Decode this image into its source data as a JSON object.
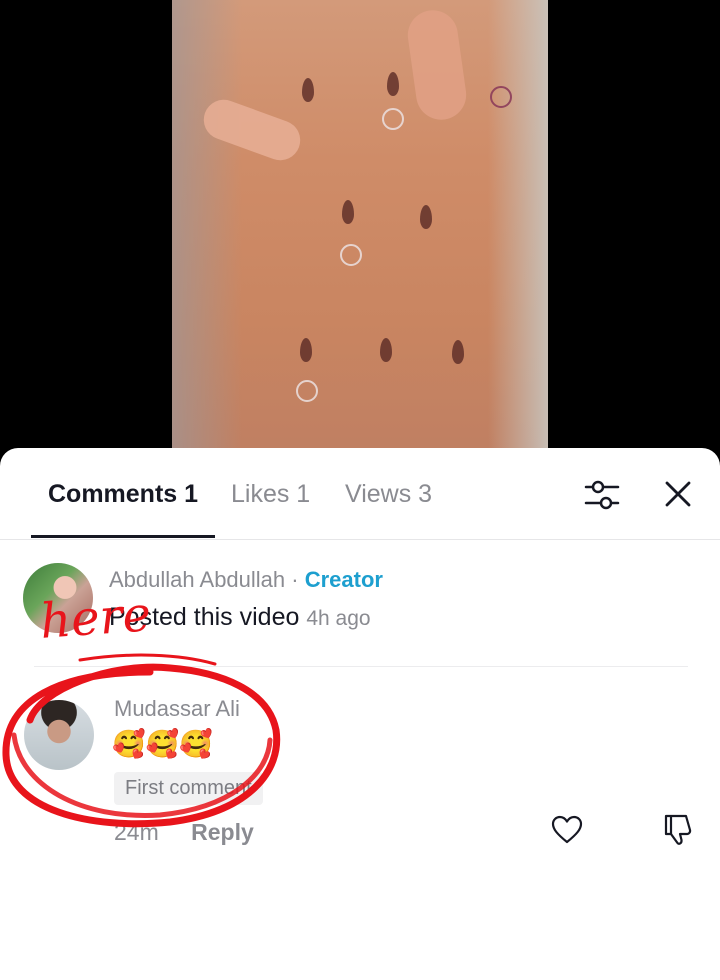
{
  "tabs": [
    {
      "label": "Comments 1",
      "active": true
    },
    {
      "label": "Likes 1",
      "active": false
    },
    {
      "label": "Views 3",
      "active": false
    }
  ],
  "icons": {
    "filter": "sliders-icon",
    "close": "close-icon",
    "like": "heart-icon",
    "dislike": "thumbs-down-icon"
  },
  "post": {
    "author": "Abdullah Abdullah",
    "separator": "·",
    "creator_label": "Creator",
    "text": "Posted this video",
    "time": "4h ago"
  },
  "comment": {
    "author": "Mudassar Ali",
    "text": "🥰🥰🥰",
    "badge": "First comment",
    "time": "24m",
    "reply_label": "Reply"
  },
  "annotation": {
    "text": "here",
    "color": "#e8141b"
  },
  "colors": {
    "accent": "#1d9fcf",
    "primary_text": "#161823",
    "secondary_text": "#8a8b91"
  }
}
